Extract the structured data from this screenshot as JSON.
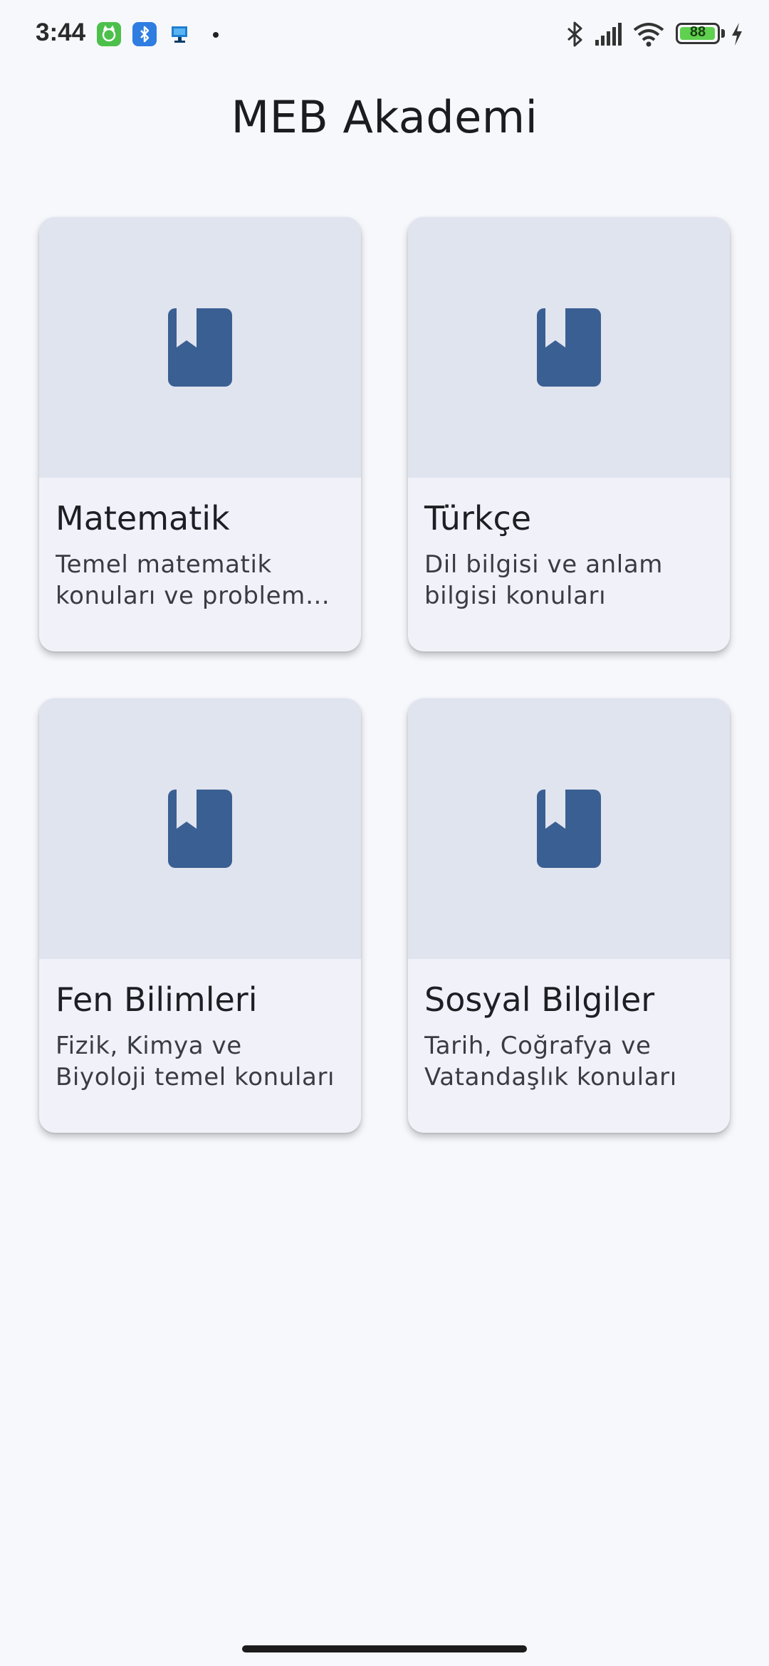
{
  "status_bar": {
    "time": "3:44",
    "battery_level": "88",
    "battery_fraction": 0.88,
    "icons": [
      "cat-app-icon",
      "bluetooth-app-icon",
      "monitor-app-icon",
      "bluetooth-icon",
      "signal-icon",
      "wifi-icon",
      "battery-icon",
      "charging-icon"
    ]
  },
  "app": {
    "title": "MEB Akademi"
  },
  "courses": [
    {
      "title": "Matematik",
      "description": "Temel matematik konuları ve problem çözme",
      "icon": "book-icon"
    },
    {
      "title": "Türkçe",
      "description": "Dil bilgisi ve anlam bilgisi konuları",
      "icon": "book-icon"
    },
    {
      "title": "Fen Bilimleri",
      "description": "Fizik, Kimya ve Biyoloji temel konuları",
      "icon": "book-icon"
    },
    {
      "title": "Sosyal Bilgiler",
      "description": "Tarih, Coğrafya ve Vatandaşlık konuları",
      "icon": "book-icon"
    }
  ],
  "colors": {
    "background": "#f7f8fc",
    "card": "#f1f2f9",
    "card_media": "#e0e4ef",
    "icon_accent": "#3a5f92"
  }
}
